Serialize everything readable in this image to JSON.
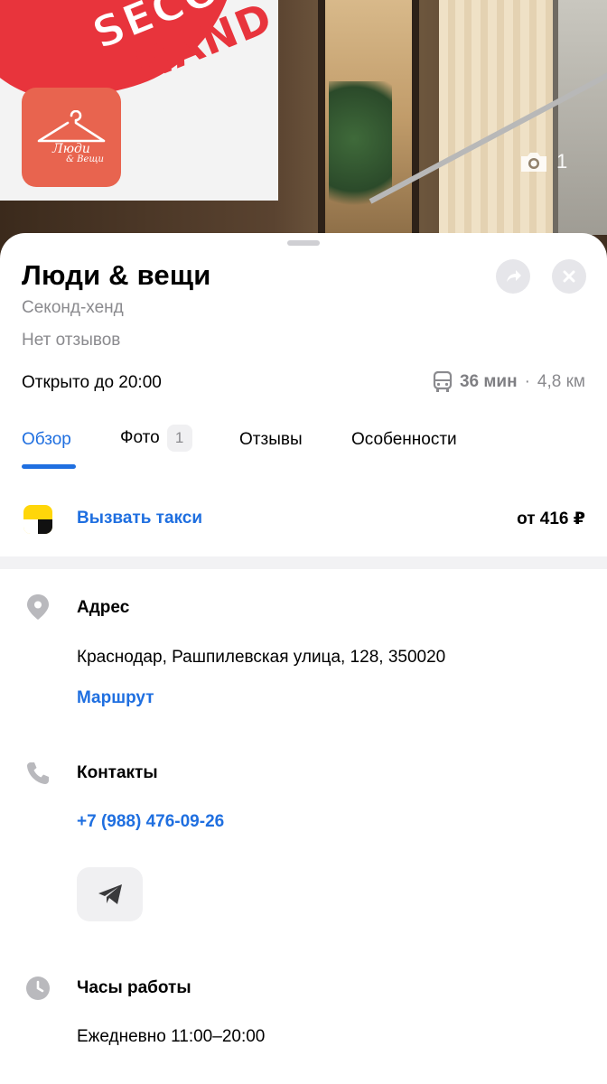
{
  "hero": {
    "banner_line1": "SECOND",
    "banner_line2": "HAND",
    "logo_name": "Люди",
    "logo_sub": "& Вещи",
    "photo_count": "1",
    "accent_red": "#e8343c",
    "logo_bg": "#e8644f"
  },
  "place": {
    "name": "Люди & вещи",
    "category": "Секонд-хенд",
    "reviews": "Нет отзывов",
    "open_status": "Открыто до 20:00",
    "transit_time": "36 мин",
    "transit_separator": "·",
    "transit_distance": "4,8 км"
  },
  "tabs": [
    {
      "label": "Обзор",
      "active": true
    },
    {
      "label": "Фото",
      "badge": "1"
    },
    {
      "label": "Отзывы"
    },
    {
      "label": "Особенности"
    }
  ],
  "taxi": {
    "label": "Вызвать такси",
    "price": "от 416 ₽"
  },
  "address": {
    "title": "Адрес",
    "value": "Краснодар, Рашпилевская улица, 128, 350020",
    "route_link": "Маршрут"
  },
  "contacts": {
    "title": "Контакты",
    "phone": "+7 (988) 476-09-26",
    "messenger_icon": "telegram-icon"
  },
  "hours": {
    "title": "Часы работы",
    "value": "Ежедневно 11:00–20:00"
  },
  "colors": {
    "link_blue": "#1f6fe0",
    "muted_gray": "#8a8a8e",
    "taxi_yellow": "#ffd60a"
  }
}
